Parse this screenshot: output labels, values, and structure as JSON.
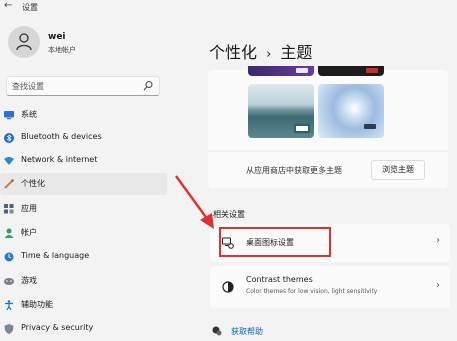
{
  "app": {
    "back_glyph": "←",
    "title": "设置"
  },
  "user": {
    "name": "wei",
    "account_type": "本地帐户"
  },
  "search": {
    "placeholder": "查找设置"
  },
  "nav": [
    {
      "label": "系统",
      "icon": "monitor-icon",
      "color": "#2f6fd6"
    },
    {
      "label": "Bluetooth & devices",
      "icon": "bluetooth-icon",
      "color": "#1c6fd1"
    },
    {
      "label": "Network & internet",
      "icon": "wifi-icon",
      "color": "#2a8ad4"
    },
    {
      "label": "个性化",
      "icon": "brush-icon",
      "color": "#c9803a"
    },
    {
      "label": "应用",
      "icon": "apps-icon",
      "color": "#50627a"
    },
    {
      "label": "帐户",
      "icon": "person-icon",
      "color": "#2aa06a"
    },
    {
      "label": "Time & language",
      "icon": "globe-clock-icon",
      "color": "#2f78c9"
    },
    {
      "label": "游戏",
      "icon": "gamepad-icon",
      "color": "#7a7f86"
    },
    {
      "label": "辅助功能",
      "icon": "accessibility-icon",
      "color": "#1a74c9"
    },
    {
      "label": "Privacy & security",
      "icon": "shield-icon",
      "color": "#7b8593"
    }
  ],
  "page": {
    "breadcrumb_parent": "个性化",
    "separator": "›",
    "title": "主题"
  },
  "store": {
    "text": "从应用商店中获取更多主题",
    "button": "浏览主题"
  },
  "related": {
    "heading": "相关设置",
    "items": [
      {
        "title": "桌面图标设置",
        "subtitle": ""
      },
      {
        "title": "Contrast themes",
        "subtitle": "Color themes for low vision, light sensitivity"
      }
    ]
  },
  "help": {
    "label": "获取帮助"
  },
  "colors": {
    "accent": "#0067c0",
    "highlight_box": "#e03030",
    "arrow": "#e03030"
  }
}
